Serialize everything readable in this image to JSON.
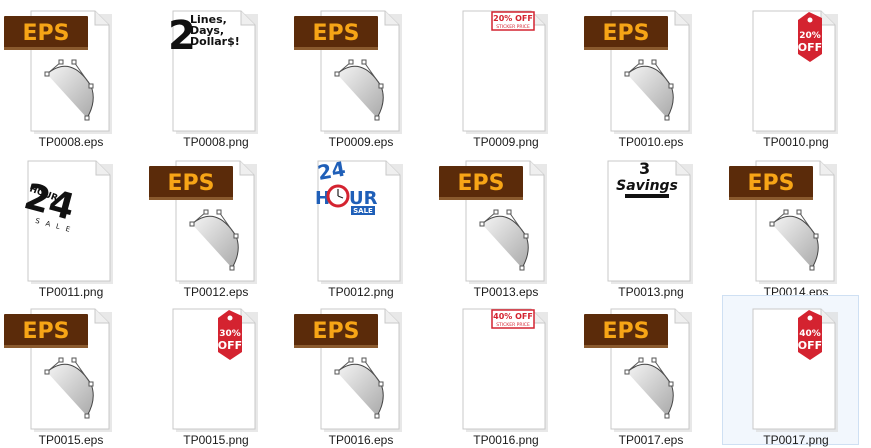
{
  "files": [
    {
      "name": "TP0008.eps",
      "type": "eps",
      "badge": "EPS"
    },
    {
      "name": "TP0008.png",
      "type": "png",
      "art": "two-lines",
      "art_text": [
        "2",
        "Lines,",
        "Days,",
        "Dollar$!"
      ]
    },
    {
      "name": "TP0009.eps",
      "type": "eps",
      "badge": "EPS"
    },
    {
      "name": "TP0009.png",
      "type": "png",
      "art": "sticker-20",
      "art_text": [
        "20% OFF",
        "STICKER PRICE"
      ]
    },
    {
      "name": "TP0010.eps",
      "type": "eps",
      "badge": "EPS"
    },
    {
      "name": "TP0010.png",
      "type": "png",
      "art": "tag-20",
      "art_text": [
        "20%",
        "OFF"
      ]
    },
    {
      "name": "TP0011.png",
      "type": "png",
      "art": "hour-24",
      "art_text": [
        "HOUR",
        "24",
        "SALE"
      ]
    },
    {
      "name": "TP0012.eps",
      "type": "eps",
      "badge": "EPS"
    },
    {
      "name": "TP0012.png",
      "type": "png",
      "art": "hour-sale",
      "art_text": [
        "24",
        "H",
        "UR",
        "SALE"
      ]
    },
    {
      "name": "TP0013.eps",
      "type": "eps",
      "badge": "EPS"
    },
    {
      "name": "TP0013.png",
      "type": "png",
      "art": "savings",
      "art_text": [
        "3",
        "Savings"
      ]
    },
    {
      "name": "TP0014.eps",
      "type": "eps",
      "badge": "EPS"
    },
    {
      "name": "TP0015.eps",
      "type": "eps",
      "badge": "EPS"
    },
    {
      "name": "TP0015.png",
      "type": "png",
      "art": "tag-30",
      "art_text": [
        "30%",
        "OFF"
      ]
    },
    {
      "name": "TP0016.eps",
      "type": "eps",
      "badge": "EPS"
    },
    {
      "name": "TP0016.png",
      "type": "png",
      "art": "sticker-40",
      "art_text": [
        "40% OFF",
        "STICKER PRICE"
      ]
    },
    {
      "name": "TP0017.eps",
      "type": "eps",
      "badge": "EPS"
    },
    {
      "name": "TP0017.png",
      "type": "png",
      "art": "tag-40",
      "art_text": [
        "40%",
        "OFF"
      ],
      "selected": true
    }
  ],
  "colors": {
    "badge_bg": "#5b2b0a",
    "badge_text": "#f7a516",
    "tag_red": "#d42330",
    "selection_bg": "#f2f7fd"
  }
}
